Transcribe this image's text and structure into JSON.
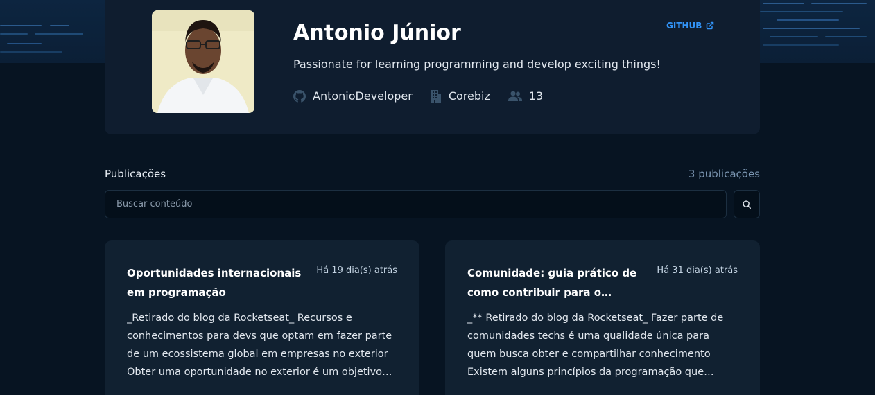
{
  "profile": {
    "name": "Antonio Júnior",
    "github_label": "GITHUB",
    "bio": "Passionate for learning programming and develop exciting things!",
    "username": "AntonioDeveloper",
    "company": "Corebiz",
    "followers": "13",
    "avatar_alt": "avatar"
  },
  "publications": {
    "title": "Publicações",
    "count": "3  publicações",
    "search_placeholder": "Buscar conteúdo",
    "posts": [
      {
        "title": "Oportunidades internacionais em programação",
        "date": "Há 19 dia(s) atrás",
        "excerpt": "_Retirado do blog da Rocketseat_ Recursos e conhecimentos para devs que optam em fazer parte de um ecossistema global em empresas no exterior Obter uma oportunidade no exterior é um objetivo e..."
      },
      {
        "title": "Comunidade: guia prático de como contribuir para o ecossistema de...",
        "date": "Há 31 dia(s) atrás",
        "excerpt": "_** Retirado do blog da Rocketseat_ Fazer parte de comunidades techs é uma qualidade única para quem busca obter e compartilhar conhecimento Existem alguns princípios da programação que historicament..."
      }
    ]
  },
  "colors": {
    "background": "#071422",
    "card": "#0f1d2f",
    "accent": "#3294f8",
    "muted": "#7b96b2"
  },
  "icons": [
    "github-icon",
    "building-icon",
    "users-icon",
    "external-link-icon",
    "search-icon"
  ]
}
